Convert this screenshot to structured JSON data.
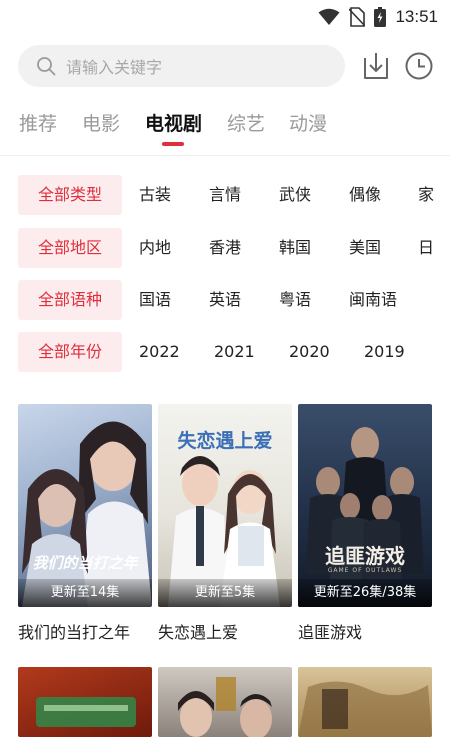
{
  "status_bar": {
    "time": "13:51"
  },
  "search": {
    "placeholder": "请输入关键字"
  },
  "tabs": [
    {
      "label": "推荐"
    },
    {
      "label": "电影"
    },
    {
      "label": "电视剧"
    },
    {
      "label": "综艺"
    },
    {
      "label": "动漫"
    }
  ],
  "active_tab": "电视剧",
  "filters": {
    "type": {
      "selected": "全部类型",
      "options": [
        "古装",
        "言情",
        "武侠",
        "偶像",
        "家"
      ]
    },
    "region": {
      "selected": "全部地区",
      "options": [
        "内地",
        "香港",
        "韩国",
        "美国",
        "日"
      ]
    },
    "language": {
      "selected": "全部语种",
      "options": [
        "国语",
        "英语",
        "粤语",
        "闽南语"
      ]
    },
    "year": {
      "selected": "全部年份",
      "options": [
        "2022",
        "2021",
        "2020",
        "2019"
      ]
    }
  },
  "cards": [
    {
      "title": "我们的当打之年",
      "update": "更新至14集",
      "poster_text": "我们的当打之年"
    },
    {
      "title": "失恋遇上爱",
      "update": "更新至5集",
      "poster_text": "失恋遇上爱"
    },
    {
      "title": "追匪游戏",
      "update": "更新至26集/38集",
      "poster_text": "追匪游戏",
      "poster_subtext": "GAME OF OUTLAWS"
    }
  ],
  "colors": {
    "accent": "#e02e3b",
    "chip_bg": "#fcecee"
  }
}
